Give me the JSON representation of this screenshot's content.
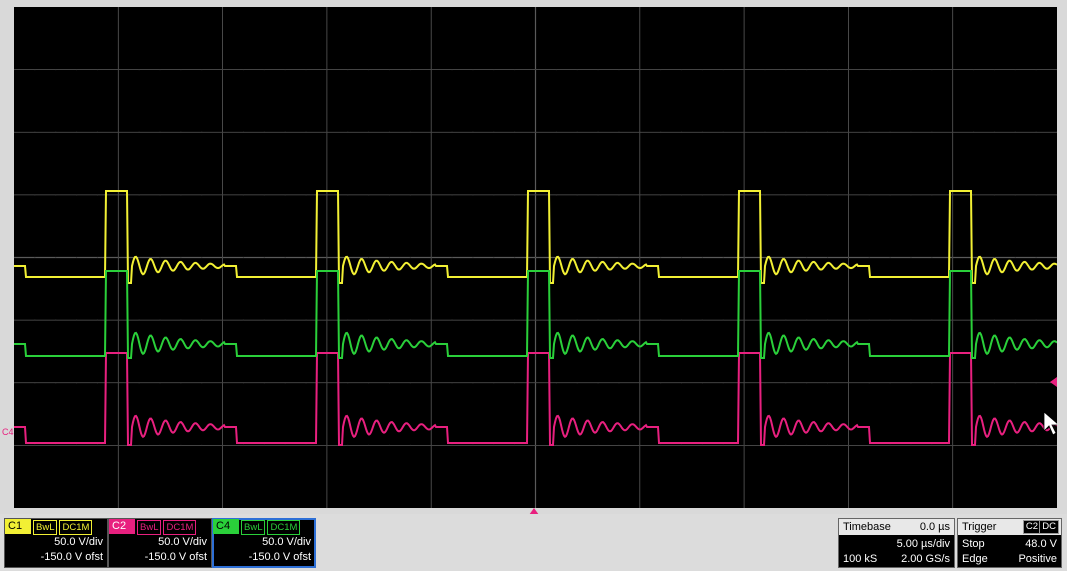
{
  "channels": [
    {
      "tag": "C1",
      "color": "#f2f034",
      "bw": "BwL",
      "coupling": "DC1M",
      "vdiv": "50.0 V/div",
      "offset": "-150.0 V ofst"
    },
    {
      "tag": "C2",
      "color": "#e8207f",
      "bw": "BwL",
      "coupling": "DC1M",
      "vdiv": "50.0 V/div",
      "offset": "-150.0 V ofst"
    },
    {
      "tag": "C4",
      "color": "#2ad03a",
      "bw": "BwL",
      "coupling": "DC1M",
      "vdiv": "50.0 V/div",
      "offset": "-150.0 V ofst"
    }
  ],
  "timebase": {
    "label": "Timebase",
    "delay": "0.0 µs",
    "tdiv": "5.00 µs/div",
    "samples": "100 kS",
    "rate": "2.00 GS/s"
  },
  "trigger": {
    "label": "Trigger",
    "source": "C2",
    "coupling": "DC",
    "mode": "Stop",
    "level": "48.0 V",
    "type": "Edge",
    "slope": "Positive"
  },
  "scope": {
    "offset_marker": "C4",
    "grid_color": "#5a5a5a"
  },
  "icons": [
    "cursor-arrow-icon",
    "trigger-level-icon",
    "trigger-position-icon"
  ]
}
